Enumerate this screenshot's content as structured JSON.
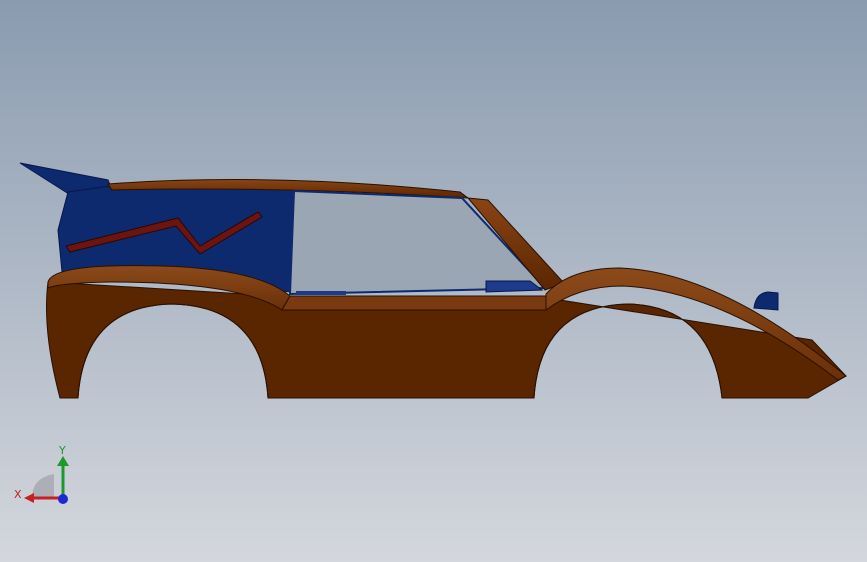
{
  "viewport": {
    "background_top": "#8a9bb0",
    "background_bottom": "#d4d7dd"
  },
  "model": {
    "name": "car-body",
    "body_color": "#5a2600",
    "body_highlight": "#7a3a10",
    "trim_color": "#3a1400",
    "interior_color": "#0e2a6e",
    "window_color": "#9aa6b4",
    "stripe_color": "#6b1510"
  },
  "triad": {
    "x_label": "X",
    "y_label": "Y",
    "x_color": "#c62020",
    "y_color": "#1a9a2a",
    "z_color": "#1a2ad0"
  }
}
